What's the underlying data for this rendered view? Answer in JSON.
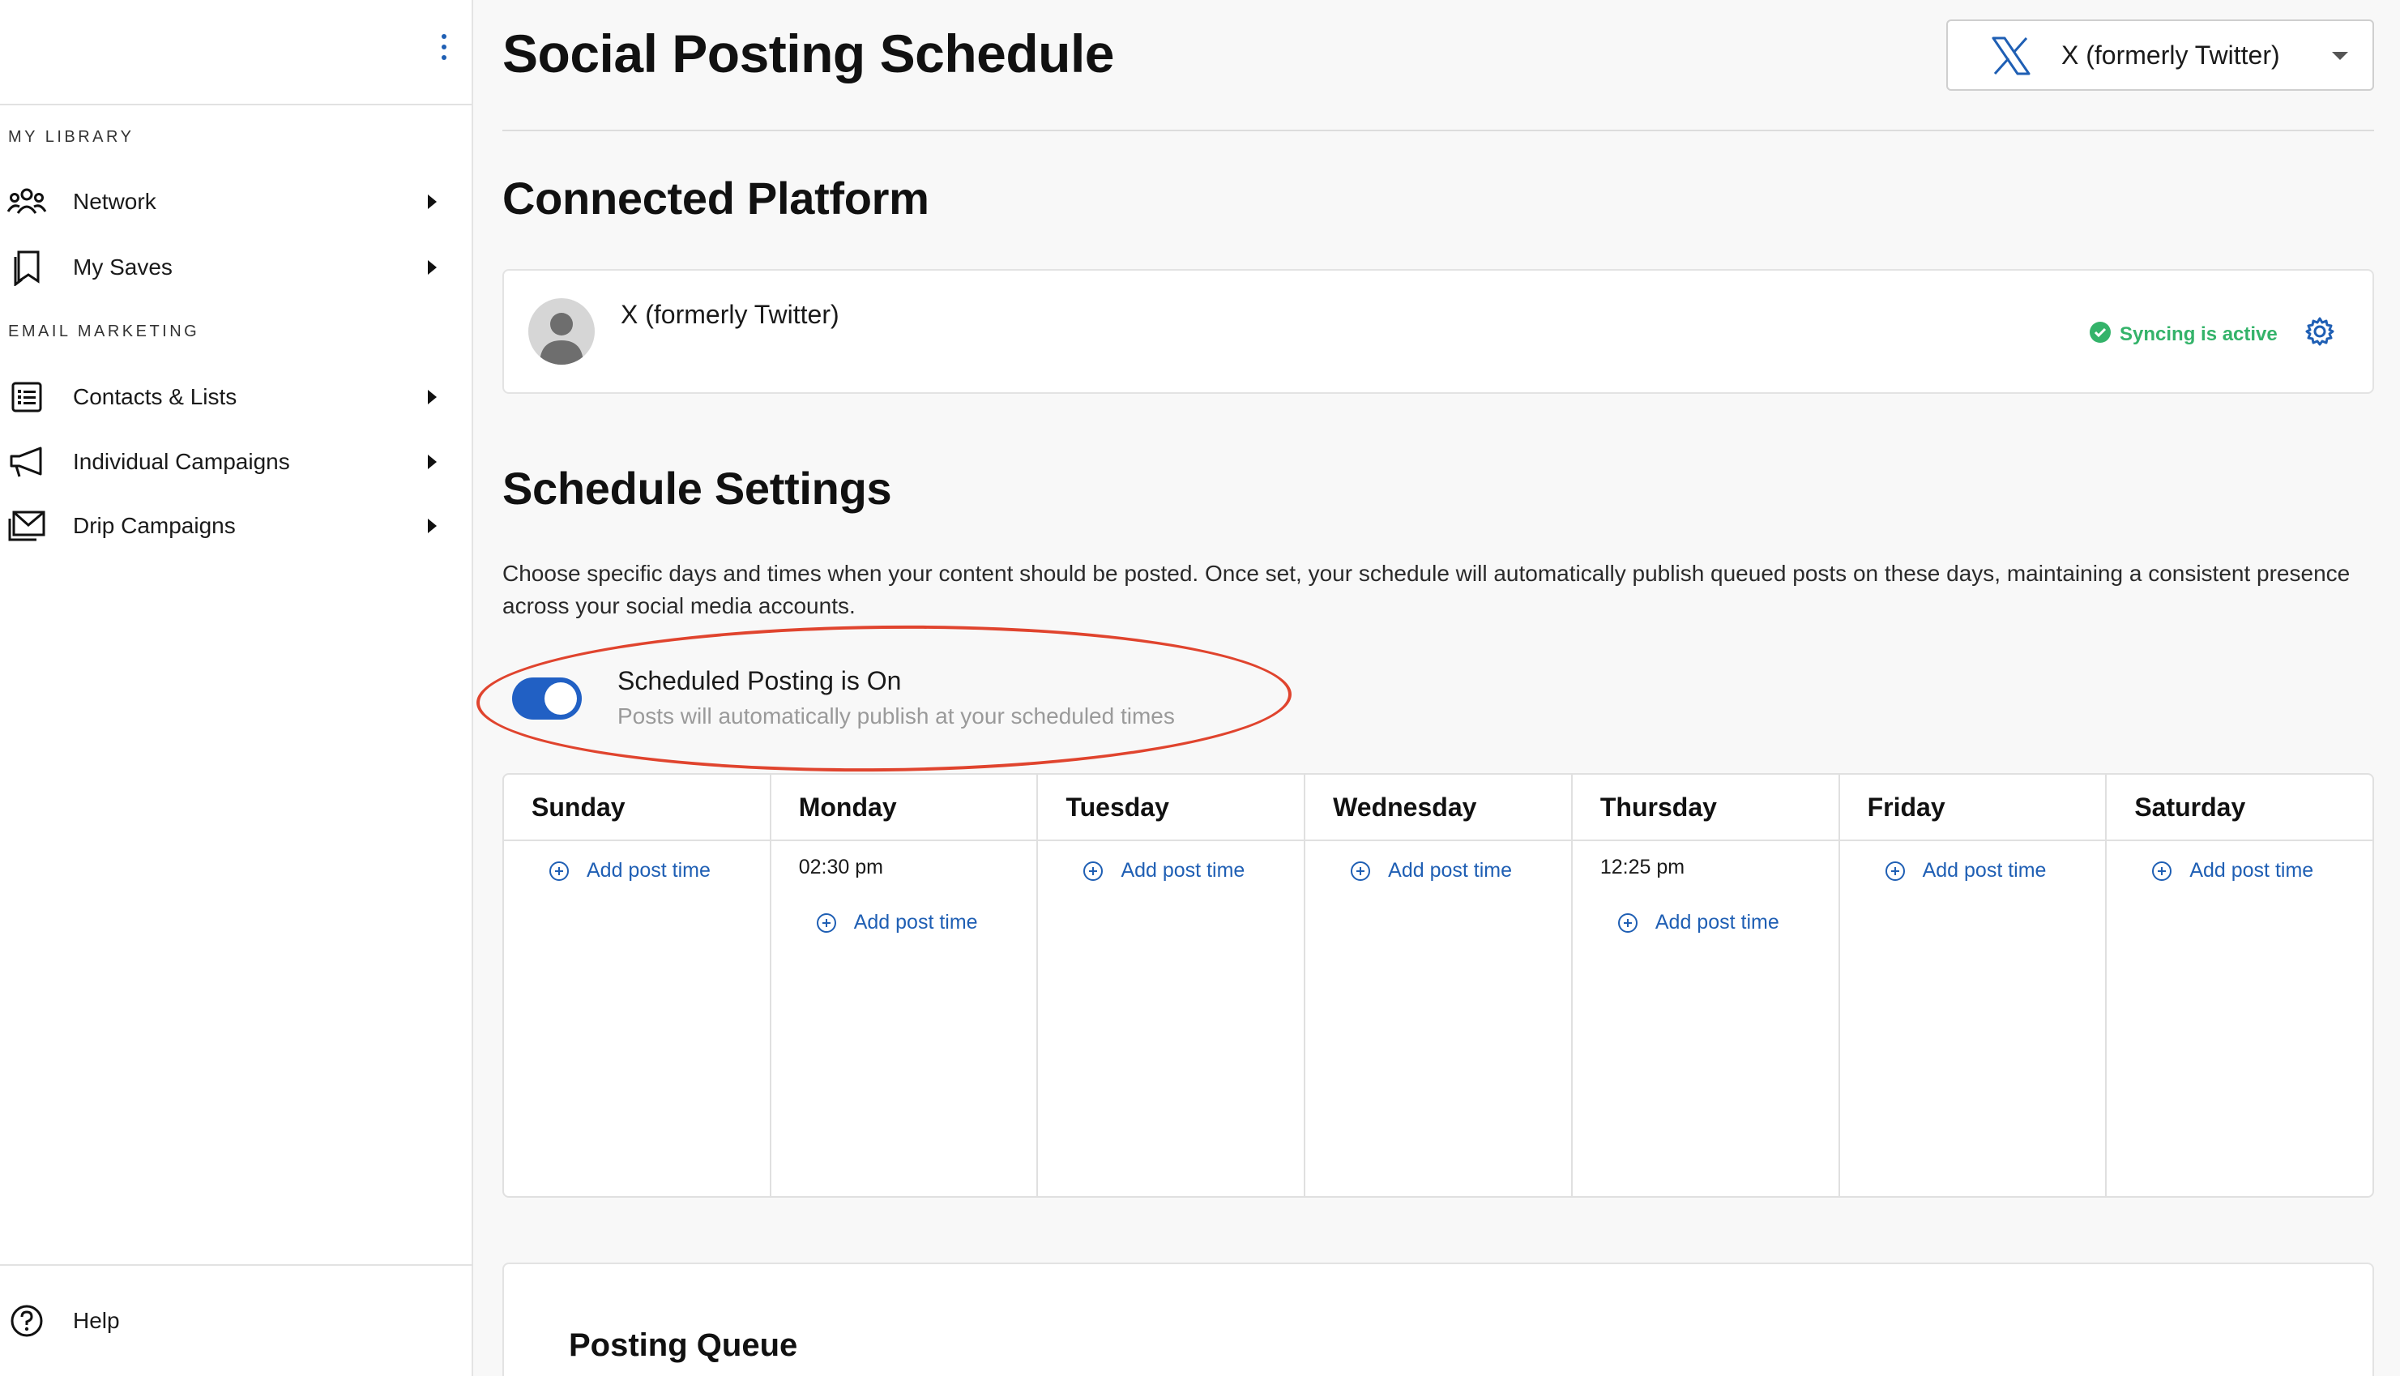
{
  "sidebar": {
    "sections": [
      {
        "label": "MY LIBRARY"
      },
      {
        "label": "EMAIL MARKETING"
      }
    ],
    "items": [
      {
        "label": "Network",
        "icon": "people-icon"
      },
      {
        "label": "My Saves",
        "icon": "bookmark-icon"
      },
      {
        "label": "Contacts & Lists",
        "icon": "list-icon"
      },
      {
        "label": "Individual Campaigns",
        "icon": "megaphone-icon"
      },
      {
        "label": "Drip Campaigns",
        "icon": "mail-icon"
      }
    ],
    "help_label": "Help"
  },
  "header": {
    "title": "Social Posting Schedule",
    "platform_select": "X (formerly Twitter)"
  },
  "connected": {
    "heading": "Connected Platform",
    "platform_name": "X (formerly Twitter)",
    "sync_status": "Syncing is active"
  },
  "schedule": {
    "heading": "Schedule Settings",
    "description": "Choose specific days and times when your content should be posted. Once set, your schedule will automatically publish queued posts on these days, maintaining a consistent presence across your social media accounts.",
    "toggle_title": "Scheduled Posting is On",
    "toggle_subtitle": "Posts will automatically publish at your scheduled times",
    "toggle_on": true,
    "add_label": "Add post time",
    "days": [
      {
        "name": "Sunday",
        "times": []
      },
      {
        "name": "Monday",
        "times": [
          "02:30 pm"
        ]
      },
      {
        "name": "Tuesday",
        "times": []
      },
      {
        "name": "Wednesday",
        "times": []
      },
      {
        "name": "Thursday",
        "times": [
          "12:25 pm"
        ]
      },
      {
        "name": "Friday",
        "times": []
      },
      {
        "name": "Saturday",
        "times": []
      }
    ]
  },
  "queue": {
    "title": "Posting Queue"
  },
  "colors": {
    "accent": "#1f5fb4",
    "toggle": "#2160c4",
    "success": "#34b36a",
    "annotation": "#e0442e"
  }
}
